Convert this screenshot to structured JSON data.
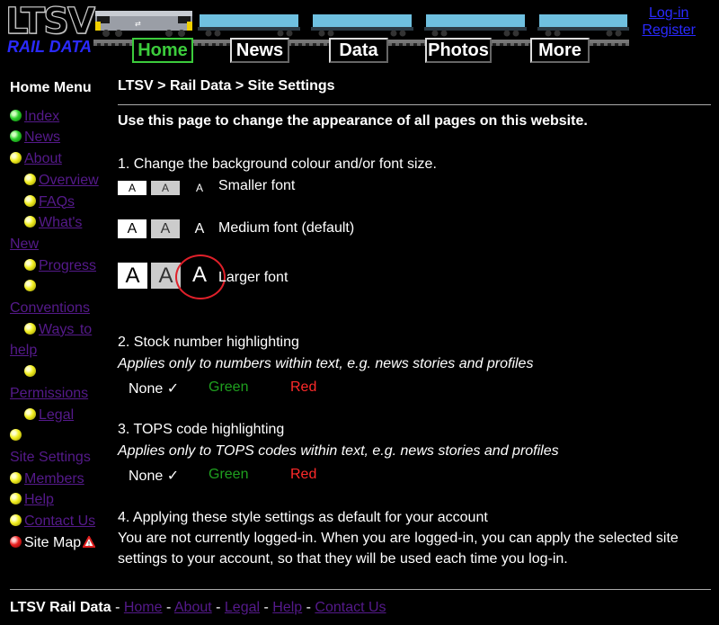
{
  "logo": {
    "top": "LTSV",
    "bottom": "RAIL DATA"
  },
  "nav": [
    {
      "label": "Home",
      "active": true
    },
    {
      "label": "News"
    },
    {
      "label": "Data"
    },
    {
      "label": "Photos"
    },
    {
      "label": "More"
    }
  ],
  "account": {
    "login": "Log-in",
    "register": "Register"
  },
  "sidebar": {
    "title": "Home Menu",
    "items": [
      {
        "label": "Index",
        "dot": "green"
      },
      {
        "label": "News",
        "dot": "green"
      },
      {
        "label": "About",
        "dot": "yellow"
      },
      {
        "label": "Overview",
        "dot": "yellow",
        "indent": true
      },
      {
        "label": "FAQs",
        "dot": "yellow",
        "indent": true
      },
      {
        "label": "What's New",
        "dot": "yellow",
        "indent": true
      },
      {
        "label": "Progress",
        "dot": "yellow",
        "indent": true
      },
      {
        "label": "Conventions",
        "dot": "yellow",
        "indent": true
      },
      {
        "label": "Ways to help",
        "dot": "yellow",
        "indent": true
      },
      {
        "label": "Permissions",
        "dot": "yellow",
        "indent": true
      },
      {
        "label": "Legal",
        "dot": "yellow",
        "indent": true
      },
      {
        "label": "Site Settings",
        "dot": "yellow"
      },
      {
        "label": "Members",
        "dot": "yellow"
      },
      {
        "label": "Help",
        "dot": "yellow"
      },
      {
        "label": "Contact Us",
        "dot": "yellow"
      },
      {
        "label": "Site Map",
        "dot": "red"
      }
    ]
  },
  "breadcrumb": "LTSV > Rail Data > Site Settings",
  "intro": "Use this page to change the appearance of all pages on this website.",
  "section1": {
    "heading": "1. Change the background colour and/or font size.",
    "glyph": "A",
    "small_label": "Smaller font",
    "medium_label": "Medium font (default)",
    "large_label": "Larger font"
  },
  "section2": {
    "heading": "2. Stock number highlighting",
    "note": "Applies only to numbers within text, e.g. news stories and profiles",
    "none": "None ✓",
    "green": "Green",
    "red": "Red"
  },
  "section3": {
    "heading": "3. TOPS code highlighting",
    "note": "Applies only to TOPS codes within text, e.g. news stories and profiles",
    "none": "None ✓",
    "green": "Green",
    "red": "Red"
  },
  "section4": {
    "heading": "4. Applying these style settings as default for your account",
    "line1": "You are not currently logged-in. When you are logged-in, you can apply the selected site",
    "line2": "settings to your account, so that they will be used each time you log-in."
  },
  "footer": {
    "brand": "LTSV Rail Data",
    "links": [
      "Home",
      "About",
      "Legal",
      "Help",
      "Contact Us"
    ],
    "sep": " - "
  },
  "colors": {
    "accent_green": "#3ccc3c",
    "visited_link": "#551a8b",
    "blue_link": "#2a2aff",
    "highlight_green": "#1fa01f",
    "highlight_red": "#ff2a2a",
    "circle": "#e0202a"
  }
}
